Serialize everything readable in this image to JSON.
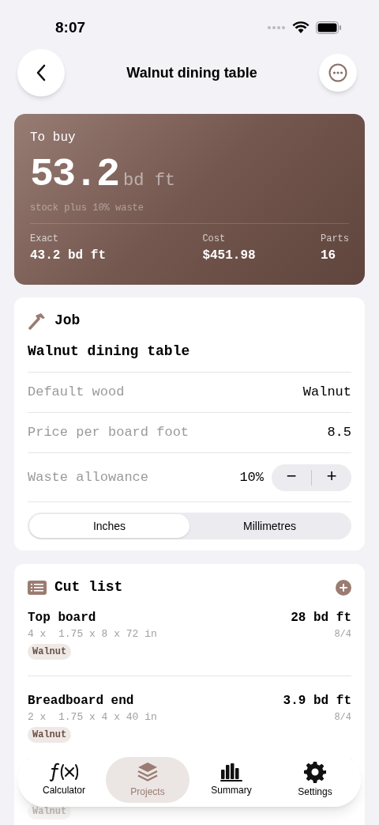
{
  "status_bar": {
    "time": "8:07"
  },
  "nav": {
    "title": "Walnut dining table"
  },
  "summary": {
    "label": "To buy",
    "amount": "53.2",
    "unit": "bd ft",
    "note": "stock plus 10% waste",
    "stats": [
      {
        "label": "Exact",
        "value": "43.2 bd ft"
      },
      {
        "label": "Cost",
        "value": "$451.98"
      },
      {
        "label": "Parts",
        "value": "16"
      }
    ]
  },
  "job": {
    "heading": "Job",
    "name": "Walnut dining table",
    "fields": [
      {
        "kind": "text",
        "label": "Default wood",
        "value": "Walnut"
      },
      {
        "kind": "text",
        "label": "Price per board foot",
        "value": "8.5"
      },
      {
        "kind": "stepper",
        "label": "Waste allowance",
        "value": "10%",
        "minus": "−",
        "plus": "+"
      }
    ],
    "units": [
      {
        "label": "Inches",
        "selected": true
      },
      {
        "label": "Millimetres",
        "selected": false
      }
    ]
  },
  "cut_list": {
    "heading": "Cut list",
    "items": [
      {
        "name": "Top board",
        "dims": "4 x  1.75 x 8 x 72 in",
        "wood": "Walnut",
        "volume": "28 bd ft",
        "thickness": "8/4"
      },
      {
        "name": "Breadboard end",
        "dims": "2 x  1.75 x 4 x 40 in",
        "wood": "Walnut",
        "volume": "3.9 bd ft",
        "thickness": "8/4"
      },
      {
        "wood": "Walnut"
      }
    ]
  },
  "tab_bar": [
    {
      "label": "Calculator",
      "selected": false
    },
    {
      "label": "Projects",
      "selected": true
    },
    {
      "label": "Summary",
      "selected": false
    },
    {
      "label": "Settings",
      "selected": false
    }
  ]
}
